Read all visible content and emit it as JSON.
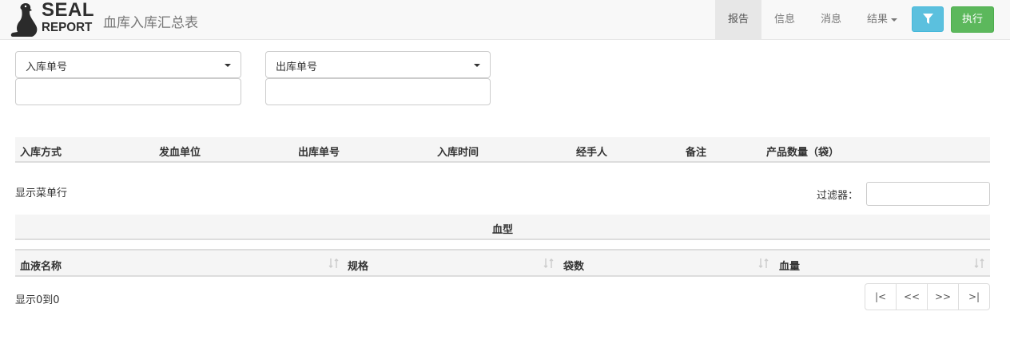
{
  "app": {
    "logo_top": "SEAL",
    "logo_bottom": "REPORT",
    "title": "血库入库汇总表"
  },
  "nav": {
    "items": [
      {
        "label": "报告",
        "active": true
      },
      {
        "label": "信息",
        "active": false
      },
      {
        "label": "消息",
        "active": false
      },
      {
        "label": "结果",
        "active": false,
        "dropdown": true
      }
    ],
    "filter_icon": "filter-icon",
    "execute_label": "执行",
    "colors": {
      "filter_button": "#5bc0de",
      "execute_button": "#5cb85c"
    }
  },
  "restrictions": [
    {
      "label": "入库单号",
      "value": ""
    },
    {
      "label": "出库单号",
      "value": ""
    }
  ],
  "summary_table": {
    "columns": [
      "入库方式",
      "发血单位",
      "出库单号",
      "入库时间",
      "经手人",
      "备注",
      "产品数量（袋）"
    ]
  },
  "menu_toggle": "显示菜单行",
  "filter": {
    "label": "过滤器：",
    "value": ""
  },
  "detail_table": {
    "group_header": "血型",
    "columns": [
      "血液名称",
      "规格",
      "袋数",
      "血量"
    ],
    "sort_icon": "sort-icon"
  },
  "table_info": "显示0到0",
  "pager": [
    "|<",
    "<<",
    ">>",
    ">|"
  ]
}
